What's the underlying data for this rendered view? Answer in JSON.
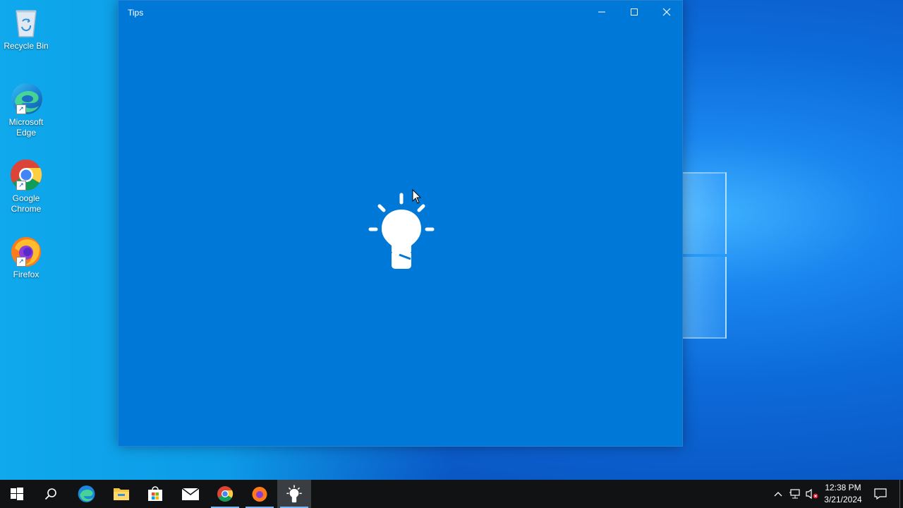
{
  "desktop": {
    "icons": [
      {
        "label": "Recycle Bin",
        "icon": "recycle-bin-icon"
      },
      {
        "label": "Microsoft Edge",
        "icon": "edge-icon"
      },
      {
        "label": "Google Chrome",
        "icon": "chrome-icon"
      },
      {
        "label": "Firefox",
        "icon": "firefox-icon"
      }
    ]
  },
  "window": {
    "title": "Tips",
    "controls": [
      "minimize",
      "maximize",
      "close"
    ],
    "splash_icon": "lightbulb-icon",
    "accent": "#0078d7"
  },
  "taskbar": {
    "items": [
      "start",
      "search",
      "edge",
      "file-explorer",
      "microsoft-store",
      "mail",
      "chrome",
      "firefox",
      "tips"
    ],
    "active": "tips",
    "clock": {
      "time": "12:38 PM",
      "date": "3/21/2024"
    }
  }
}
